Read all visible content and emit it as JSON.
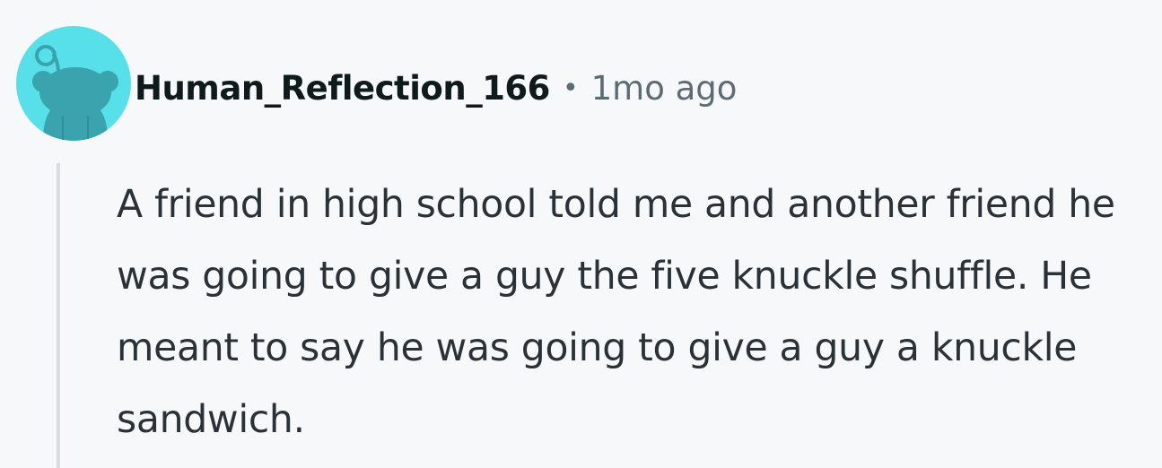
{
  "comment": {
    "author": "Human_Reflection_166",
    "separator": "•",
    "timestamp": "1mo ago",
    "avatar_icon": "snoo-avatar-icon",
    "body": "A friend in high school told me and another friend he was going to give a guy the five knuckle shuffle. He meant to say he was going to give a guy a knuckle sandwich."
  },
  "colors": {
    "background": "#f7f8fa",
    "avatar_background": "#57e0ea",
    "avatar_figure": "#3aa3ad",
    "author_text": "#0f1a1c",
    "meta_text": "#5c6c74",
    "body_text": "#2a3237",
    "thread_line": "#d6dde1"
  }
}
